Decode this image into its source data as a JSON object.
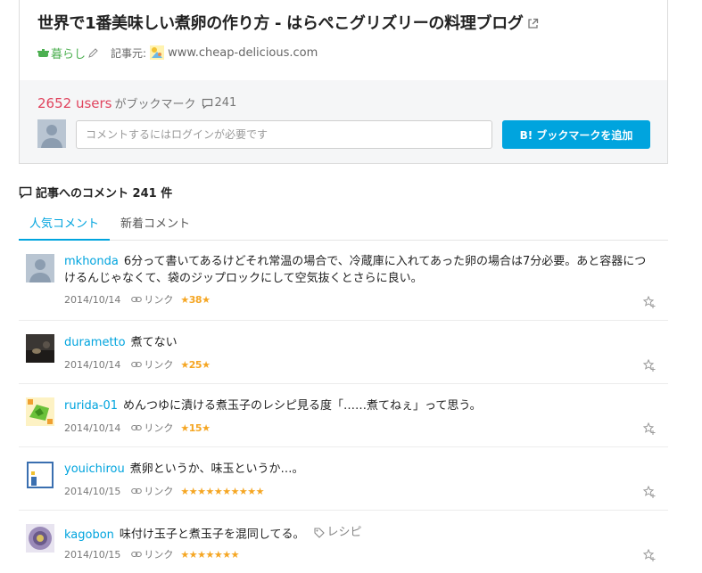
{
  "entry": {
    "title": "世界で1番美味しい煮卵の作り方 - はらぺこグリズリーの料理ブログ",
    "category": "暮らし",
    "source_label": "記事元:",
    "source_domain": "www.cheap-delicious.com"
  },
  "bookmark": {
    "users_count": "2652 users",
    "users_suffix": "がブックマーク",
    "comment_count": "241",
    "comment_placeholder": "コメントするにはログインが必要です",
    "add_button_label": "B! ブックマークを追加"
  },
  "comments_section": {
    "title": "記事へのコメント 241 件",
    "tabs": [
      {
        "label": "人気コメント",
        "active": true
      },
      {
        "label": "新着コメント",
        "active": false
      }
    ]
  },
  "comments": [
    {
      "user": "mkhonda",
      "text": "6分って書いてあるけどそれ常温の場合で、冷蔵庫に入れてあった卵の場合は7分必要。あと容器につけるんじゃなくて、袋のジップロックにして空気抜くとさらに良い。",
      "date": "2014/10/14",
      "link_label": "リンク",
      "stars": "★38★",
      "tag": ""
    },
    {
      "user": "durametto",
      "text": "煮てない",
      "date": "2014/10/14",
      "link_label": "リンク",
      "stars": "★25★",
      "tag": ""
    },
    {
      "user": "rurida-01",
      "text": "めんつゆに漬ける煮玉子のレシピ見る度「……煮てねぇ」って思う。",
      "date": "2014/10/14",
      "link_label": "リンク",
      "stars": "★15★",
      "tag": ""
    },
    {
      "user": "youichirou",
      "text": "煮卵というか、味玉というか…。",
      "date": "2014/10/15",
      "link_label": "リンク",
      "stars": "★★★★★★★★★★",
      "tag": ""
    },
    {
      "user": "kagobon",
      "text": "味付け玉子と煮玉子を混同してる。",
      "date": "2014/10/15",
      "link_label": "リンク",
      "stars": "★★★★★★★",
      "tag": "レシピ"
    }
  ],
  "colors": {
    "accent": "#00a4de",
    "users_count": "#e0445e",
    "category": "#4caf50",
    "stars": "#f5a623"
  },
  "icons": [
    "external-link-icon",
    "pot-icon",
    "pencil-icon",
    "favicon-icon",
    "comment-bubble-icon",
    "link-icon",
    "tag-icon",
    "add-star-icon"
  ]
}
